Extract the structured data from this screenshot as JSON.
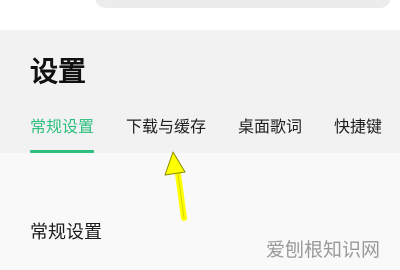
{
  "header": {
    "title": "设置"
  },
  "tabs": [
    {
      "label": "常规设置",
      "active": true
    },
    {
      "label": "下载与缓存",
      "active": false
    },
    {
      "label": "桌面歌词",
      "active": false
    },
    {
      "label": "快捷键",
      "active": false
    }
  ],
  "main": {
    "section_title": "常规设置"
  },
  "annotation": {
    "icon": "arrow-icon",
    "color": "#ffff00"
  },
  "watermark": {
    "text": "爱刨根知识网"
  },
  "colors": {
    "accent": "#2ebf7f",
    "header_bg": "#f2f2f2",
    "content_bg": "#f9f9f9"
  }
}
